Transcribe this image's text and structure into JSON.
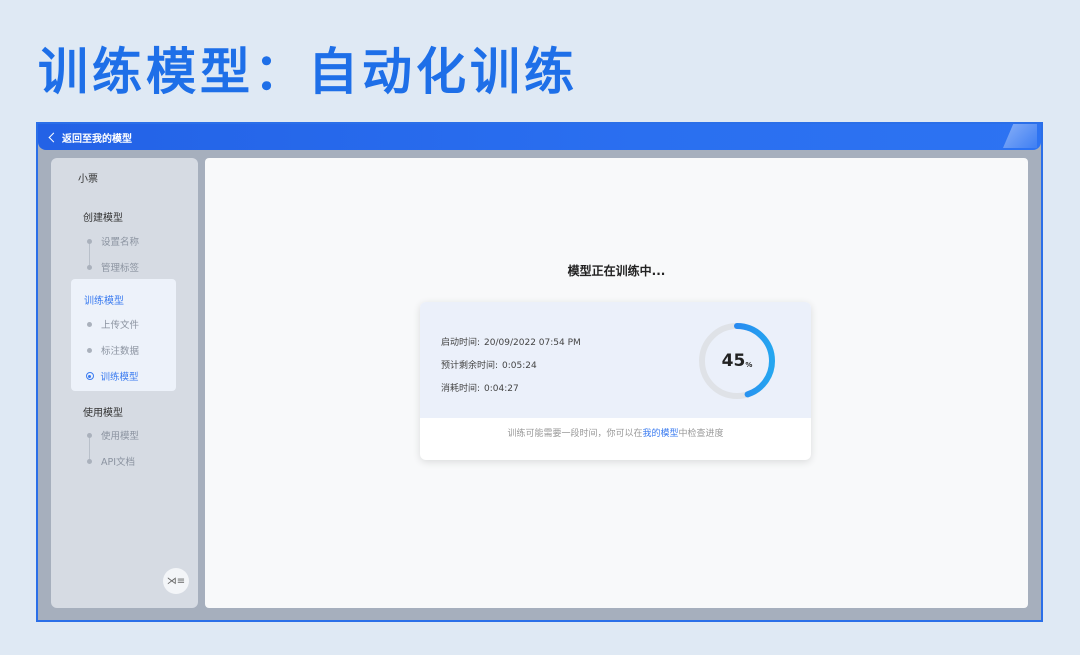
{
  "page": {
    "title": "训练模型：自动化训练"
  },
  "topbar": {
    "back_label": "返回至我的模型"
  },
  "sidebar": {
    "project_name": "小票",
    "groups": [
      {
        "title": "创建模型",
        "items": [
          "设置名称",
          "管理标签"
        ]
      },
      {
        "title": "训练模型",
        "items": [
          "上传文件",
          "标注数据",
          "训练模型"
        ]
      },
      {
        "title": "使用模型",
        "items": [
          "使用模型",
          "API文档"
        ]
      }
    ],
    "active_item": "训练模型",
    "collapse_icon": "collapse-sidebar-icon"
  },
  "main": {
    "status_title": "模型正在训练中...",
    "info": {
      "start_label": "启动时间:",
      "start_value": "20/09/2022 07:54 PM",
      "eta_label": "预计剩余时间:",
      "eta_value": "0:05:24",
      "elapsed_label": "消耗时间:",
      "elapsed_value": "0:04:27"
    },
    "progress": {
      "value": "45",
      "unit": "%",
      "fraction": 0.45
    },
    "note_before": "训练可能需要一段时间，你可以在",
    "note_link": "我的模型",
    "note_after": "中检查进度"
  },
  "colors": {
    "accent": "#3a7bf0",
    "title_blue": "#1e6fe8",
    "ring_track": "#dfe2e7",
    "ring_start": "#2a6ff0",
    "ring_end": "#25a6f0"
  }
}
